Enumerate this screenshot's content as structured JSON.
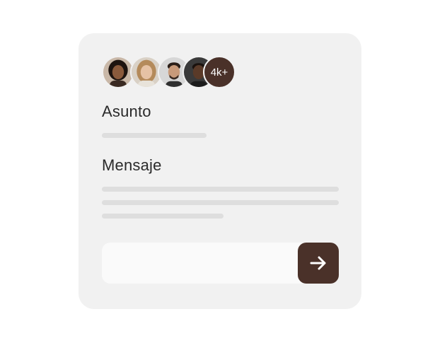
{
  "avatars": [
    {
      "name": "avatar-1",
      "skin": "#8a5a3c",
      "hair": "#1e1410",
      "bg": "#c9b8a8"
    },
    {
      "name": "avatar-2",
      "skin": "#e6c2a4",
      "hair": "#b48a5a",
      "bg": "#d9d1c6"
    },
    {
      "name": "avatar-3",
      "skin": "#c89a7a",
      "hair": "#2a1e18",
      "bg": "#d7d7d7"
    },
    {
      "name": "avatar-4",
      "skin": "#5a3a28",
      "hair": "#1a120e",
      "bg": "#3a3a3a"
    }
  ],
  "avatar_count": "4k+",
  "form": {
    "subject_label": "Asunto",
    "message_label": "Mensaje"
  },
  "icons": {
    "send": "arrow-right-icon"
  },
  "colors": {
    "accent": "#4a3129",
    "card": "#f1f1f1",
    "placeholder_line": "#dedede"
  }
}
